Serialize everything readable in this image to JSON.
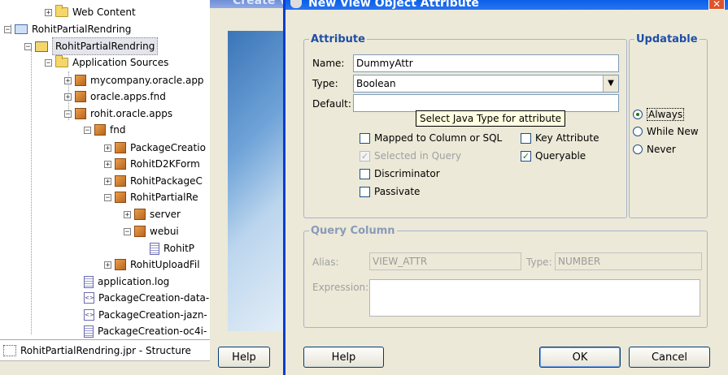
{
  "navigator": {
    "nodes": [
      {
        "label": "Web Content"
      },
      {
        "label": "RohitPartialRendring"
      },
      {
        "label": "RohitPartialRendring"
      },
      {
        "label": "Application Sources"
      },
      {
        "label": "mycompany.oracle.app"
      },
      {
        "label": "oracle.apps.fnd"
      },
      {
        "label": "rohit.oracle.apps"
      },
      {
        "label": "fnd"
      },
      {
        "label": "PackageCreatio"
      },
      {
        "label": "RohitD2KForm"
      },
      {
        "label": "RohitPackageC"
      },
      {
        "label": "RohitPartialRe"
      },
      {
        "label": "server"
      },
      {
        "label": "webui"
      },
      {
        "label": "RohitP"
      },
      {
        "label": "RohitUploadFil"
      },
      {
        "label": "application.log"
      },
      {
        "label": "PackageCreation-data-"
      },
      {
        "label": "PackageCreation-jazn-"
      },
      {
        "label": "PackageCreation-oc4i-"
      }
    ],
    "status_text": "RohitPartialRendring.jpr - Structure"
  },
  "background_dialog": {
    "title": "Create V",
    "help_label": "Help"
  },
  "dialog": {
    "title": "New View Object Attribute",
    "close_symbol": "✕",
    "attribute": {
      "legend": "Attribute",
      "name_label": "Name:",
      "name_value": "DummyAttr",
      "type_label": "Type:",
      "type_value": "Boolean",
      "default_label": "Default:",
      "default_value": "",
      "tooltip": "Select Java Type for attribute",
      "mapped_label": "Mapped to Column or SQL",
      "selected_label": "Selected in Query",
      "discriminator_label": "Discriminator",
      "passivate_label": "Passivate",
      "key_label": "Key Attribute",
      "queryable_label": "Queryable"
    },
    "updatable": {
      "legend": "Updatable",
      "always": "Always",
      "while_new": "While New",
      "never": "Never",
      "selected": "Always"
    },
    "query_column": {
      "legend": "Query Column",
      "alias_label": "Alias:",
      "alias_value": "VIEW_ATTR",
      "type_label": "Type:",
      "type_value": "NUMBER",
      "expression_label": "Expression:",
      "expression_value": ""
    },
    "buttons": {
      "help": "Help",
      "ok": "OK",
      "cancel": "Cancel"
    },
    "checks": {
      "mapped": false,
      "selected_in_query": true,
      "discriminator": false,
      "passivate": false,
      "key_attribute": false,
      "queryable": true
    }
  }
}
